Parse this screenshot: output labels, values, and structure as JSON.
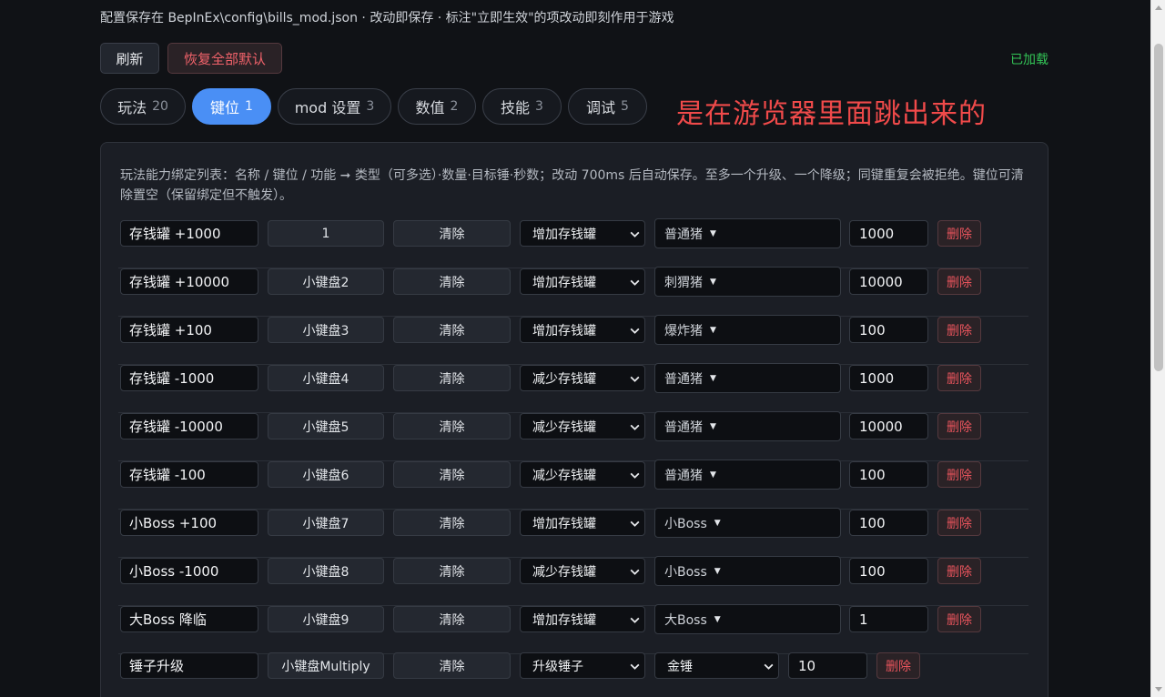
{
  "header": {
    "info": "配置保存在 BepInEx\\config\\bills_mod.json · 改动即保存 · 标注\"立即生效\"的项改动即刻作用于游戏",
    "refresh_label": "刷新",
    "reset_label": "恢复全部默认",
    "status": "已加载"
  },
  "tabs": [
    {
      "label": "玩法",
      "count": "20"
    },
    {
      "label": "键位",
      "count": "1"
    },
    {
      "label": "mod 设置",
      "count": "3"
    },
    {
      "label": "数值",
      "count": "2"
    },
    {
      "label": "技能",
      "count": "3"
    },
    {
      "label": "调试",
      "count": "5"
    }
  ],
  "active_tab": "键位",
  "annotation": "是在游览器里面跳出来的",
  "panel": {
    "description": "玩法能力绑定列表：名称 / 键位 / 功能 ➞ 类型（可多选）·数量·目标锤·秒数；改动 700ms 后自动保存。至多一个升级、一个降级；同键重复会被拒绝。键位可清除置空（保留绑定但不触发）。",
    "clear_label": "清除",
    "delete_label": "删除",
    "rows": [
      {
        "name": "存钱罐 +1000",
        "key": "1",
        "action": "增加存钱罐",
        "target": "普通猪",
        "amount": "1000"
      },
      {
        "name": "存钱罐 +10000",
        "key": "小键盘2",
        "action": "增加存钱罐",
        "target": "刺猬猪",
        "amount": "10000"
      },
      {
        "name": "存钱罐 +100",
        "key": "小键盘3",
        "action": "增加存钱罐",
        "target": "爆炸猪",
        "amount": "100"
      },
      {
        "name": "存钱罐 -1000",
        "key": "小键盘4",
        "action": "减少存钱罐",
        "target": "普通猪",
        "amount": "1000"
      },
      {
        "name": "存钱罐 -10000",
        "key": "小键盘5",
        "action": "减少存钱罐",
        "target": "普通猪",
        "amount": "10000"
      },
      {
        "name": "存钱罐 -100",
        "key": "小键盘6",
        "action": "减少存钱罐",
        "target": "普通猪",
        "amount": "100"
      },
      {
        "name": "小Boss +100",
        "key": "小键盘7",
        "action": "增加存钱罐",
        "target": "小Boss",
        "amount": "100"
      },
      {
        "name": "小Boss -1000",
        "key": "小键盘8",
        "action": "减少存钱罐",
        "target": "小Boss",
        "amount": "100"
      },
      {
        "name": "大Boss 降临",
        "key": "小键盘9",
        "action": "增加存钱罐",
        "target": "大Boss",
        "amount": "1"
      },
      {
        "name": "锤子升级",
        "key": "小键盘Multiply",
        "action": "升级锤子",
        "target": "金锤",
        "amount": "10"
      }
    ]
  }
}
